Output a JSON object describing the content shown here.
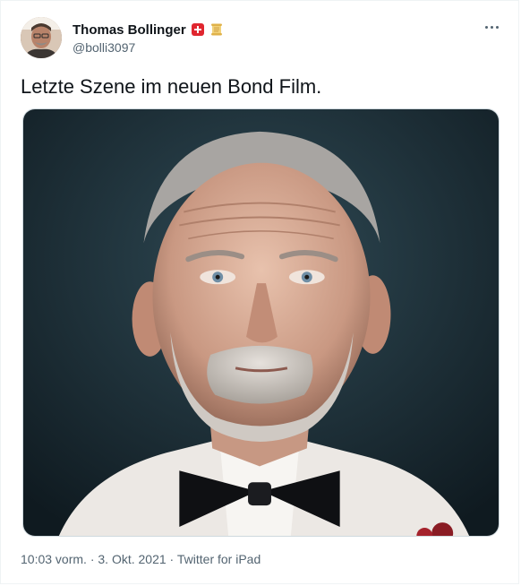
{
  "author": {
    "display_name": "Thomas Bollinger",
    "handle": "@bolli3097",
    "badges": [
      "swiss-flag-icon",
      "scroll-icon"
    ]
  },
  "tweet": {
    "text": "Letzte Szene im neuen Bond Film."
  },
  "meta": {
    "time": "10:03 vorm.",
    "separator1": " · ",
    "date": "3. Okt. 2021",
    "separator2": " · ",
    "source": "Twitter for iPad"
  },
  "colors": {
    "text_primary": "#0f1419",
    "text_secondary": "#536471",
    "border": "#eff3f4",
    "flag_red": "#e0262f"
  }
}
